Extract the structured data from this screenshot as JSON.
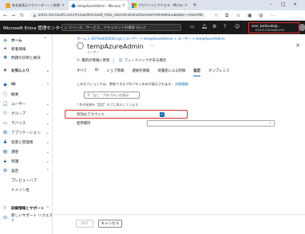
{
  "browser": {
    "tabs": [
      {
        "title": "有名者表示アカウンターー | 新規作成",
        "active": false
      },
      {
        "title": "tempAzureAdmin - Microsoft Entra...",
        "active": true
      },
      {
        "title": "アカウントにアクセス - Microsoft & ...",
        "active": false
      }
    ],
    "url": "entra.microsoft.com/#view/Microsoft_AAD_UsersAndTenants/UserProfileMenuBlade/~/UserAttributes/userId/8d27a83b-3..."
  },
  "portal": {
    "brand": "Microsoft Entra 管理センター",
    "search_placeholder": "リソース、サービス、ドキュメントの検索 (G+/)",
    "account_email": "user_kadosuki@...",
    "account_tenant": "EX370720340N.XYZ"
  },
  "sidebar": {
    "items": [
      {
        "label": "ホーム",
        "icon": "home-icon",
        "bold": true
      },
      {
        "label": "新着情報",
        "icon": "whats-new-icon"
      },
      {
        "label": "問題の診断と解決",
        "icon": "diagnose-icon"
      },
      {
        "label": "お気に入り",
        "icon": "star-icon",
        "bold": true,
        "chevron": "chevron-down-icon"
      },
      {
        "label": "ID",
        "icon": "id-icon",
        "bold": true,
        "chevron": "chevron-up-icon"
      },
      {
        "label": "概要",
        "icon": "info-icon"
      },
      {
        "label": "ユーザー",
        "icon": "user-icon",
        "chevron": "chevron-down-icon"
      },
      {
        "label": "グループ",
        "icon": "group-icon",
        "chevron": "chevron-down-icon"
      },
      {
        "label": "デバイス",
        "icon": "device-icon",
        "chevron": "chevron-down-icon"
      },
      {
        "label": "アプリケーション",
        "icon": "app-icon",
        "chevron": "chevron-down-icon"
      },
      {
        "label": "役割と管理者",
        "icon": "roles-icon",
        "chevron": "chevron-down-icon"
      },
      {
        "label": "課金",
        "icon": "billing-icon",
        "chevron": "chevron-down-icon"
      },
      {
        "label": "保護",
        "icon": "lock-icon",
        "chevron": "chevron-down-icon"
      },
      {
        "label": "設定",
        "icon": "gear-icon",
        "chevron": "chevron-up-icon"
      },
      {
        "label": "プレビューハブ",
        "icon": "",
        "sub": true
      },
      {
        "label": "ドメイン名",
        "icon": "",
        "sub": true
      },
      {
        "label": "詳細情報とサポート",
        "icon": "help-icon",
        "bold": true,
        "chevron": "chevron-up-icon"
      },
      {
        "label": "新しいサポート リクエスト",
        "icon": "support-icon"
      }
    ]
  },
  "main": {
    "breadcrumb": "ホーム > EX7ledil20400.xyz | ユーザー > tempAzureAdmin > ユーザー > tempAzureAdmin",
    "title": "tempAzureAdmin",
    "subtitle": "ユーザー",
    "toolbar": {
      "refresh": "最新の情報に更新",
      "feedback": "フィードバックがある場合"
    },
    "tabs": [
      "すべて",
      "ID",
      "ジョブ情報",
      "連絡先情報",
      "保護者による制御",
      "設定",
      "オンプレミス"
    ],
    "active_tab": "設定",
    "description": "このセクションでは、更新できるプロパティのみが表示されます。",
    "description_link": "詳細情報",
    "apply_button": "\"なし\" プロパティの表示",
    "hint": "* 件の結果を \"設定\" タブに表示しています",
    "account_enabled_label": "有効なアカウント",
    "account_enabled": true,
    "expiry_label": "使用場所"
  },
  "footer": {
    "save": "保存",
    "cancel": "キャンセル"
  }
}
